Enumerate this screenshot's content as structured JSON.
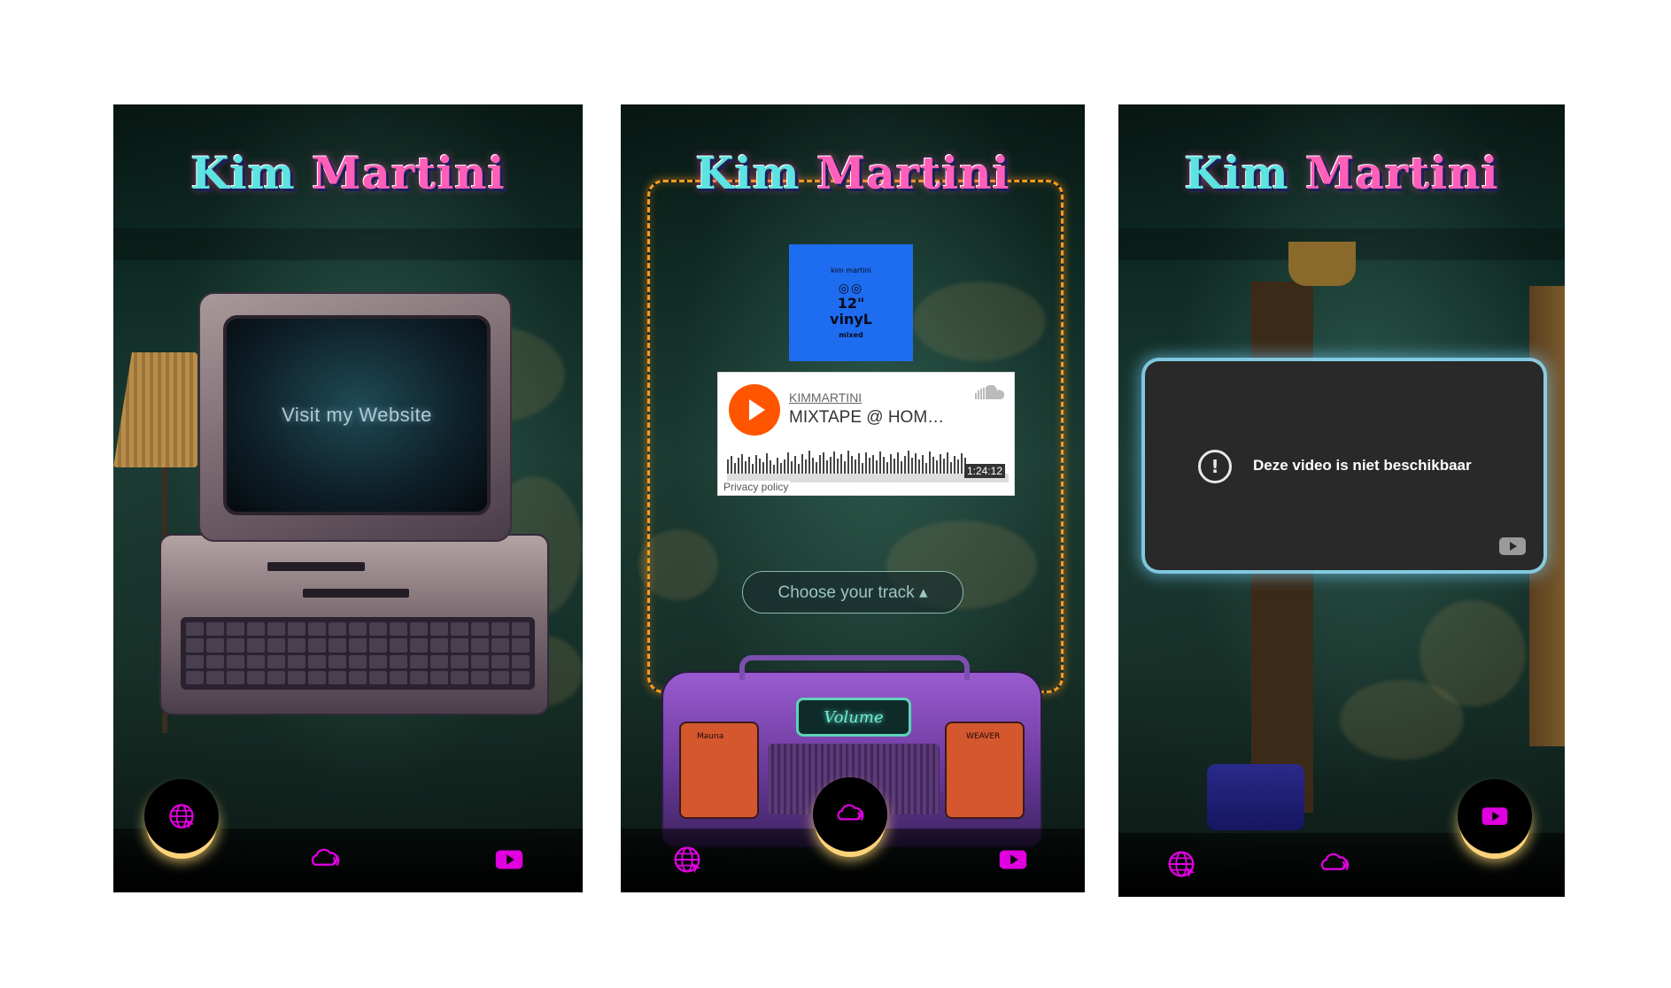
{
  "brand": {
    "part1": "Kim",
    "part2": "Martini"
  },
  "screens": {
    "website": {
      "crt_label": "Visit my Website"
    },
    "music": {
      "album": {
        "small": "kim martini",
        "line1": "12\"",
        "line2": "vinyL",
        "line3": "mixed"
      },
      "soundcloud": {
        "user": "KIMMARTINI",
        "title": "MIXTAPE @ HOM…",
        "duration": "1:24:12",
        "privacy": "Privacy policy"
      },
      "track_button": "Choose your track ▴",
      "radio": {
        "display": "Volume",
        "left_label": "Mauna",
        "right_label": "WEAVER"
      }
    },
    "video": {
      "message": "Deze video is niet beschikbaar",
      "alert_glyph": "!"
    }
  },
  "nav": {
    "items": [
      {
        "id": "website",
        "icon": "globe-icon"
      },
      {
        "id": "music",
        "icon": "soundcloud-icon"
      },
      {
        "id": "video",
        "icon": "youtube-icon"
      }
    ],
    "active_per_screen": [
      "website",
      "music",
      "video"
    ]
  },
  "colors": {
    "accent": "#e000e0",
    "brand_cyan": "#5de3e0",
    "brand_pink": "#ff5fb8",
    "flame": "#ff9a1f",
    "soundcloud": "#ff5500",
    "glow": "#ffd27a"
  }
}
